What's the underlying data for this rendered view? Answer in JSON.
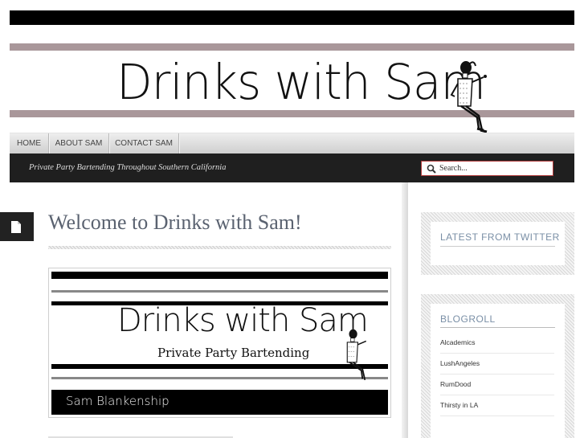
{
  "header": {
    "logo_text": "Drinks with Sam"
  },
  "nav": {
    "items": [
      {
        "label": "HOME"
      },
      {
        "label": "ABOUT SAM"
      },
      {
        "label": "CONTACT SAM"
      }
    ]
  },
  "tagline": "Private Party Bartending Throughout Southern California",
  "search": {
    "placeholder": "Search..."
  },
  "post": {
    "title": "Welcome to Drinks with Sam!",
    "banner": {
      "logo_text": "Drinks with Sam",
      "subtitle": "Private Party Bartending",
      "name": "Sam Blankenship"
    }
  },
  "sidebar": {
    "twitter_title": "LATEST FROM TWITTER",
    "blogroll_title": "BLOGROLL",
    "blogroll_links": [
      "Alcademics",
      "LushAngeles",
      "RumDood",
      "Thirsty in LA"
    ]
  },
  "colors": {
    "header_band": "#a9979a",
    "tagbar": "#1f1f1f",
    "title_text": "#5a6270",
    "widget_title": "#7a8fa6",
    "search_border": "#b03a3a"
  }
}
